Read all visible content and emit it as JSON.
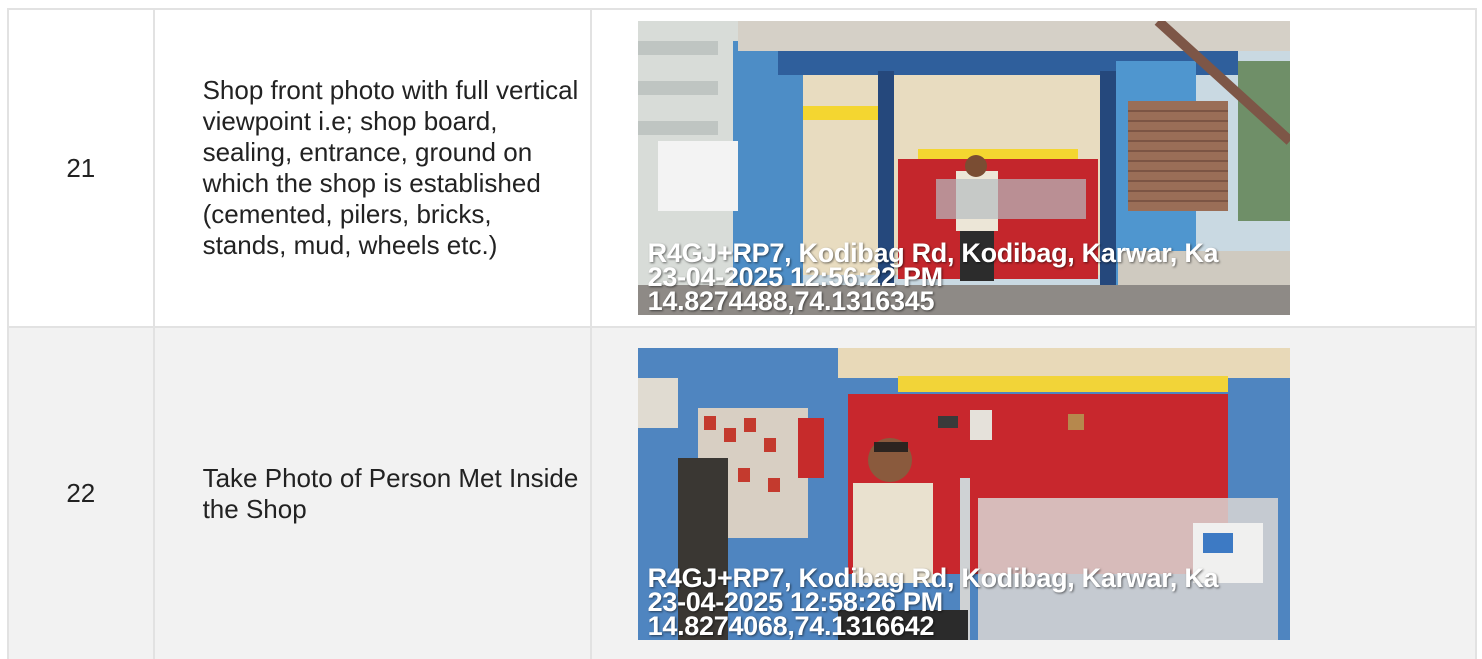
{
  "rows": [
    {
      "number": "21",
      "description": "Shop front photo with full vertical viewpoint i.e; shop board, sealing, entrance, ground on which the shop is established (cemented, pilers, bricks, stands, mud, wheels etc.)",
      "photo": {
        "address": "R4GJ+RP7, Kodibag Rd, Kodibag, Karwar, Ka",
        "timestamp": "23-04-2025 12:56:22 PM",
        "coordinates": "14.8274488,74.1316345"
      }
    },
    {
      "number": "22",
      "description": "Take Photo of Person Met Inside the Shop",
      "photo": {
        "address": "R4GJ+RP7, Kodibag Rd, Kodibag, Karwar, Ka",
        "timestamp": "23-04-2025 12:58:26 PM",
        "coordinates": "14.8274068,74.1316642"
      }
    }
  ]
}
